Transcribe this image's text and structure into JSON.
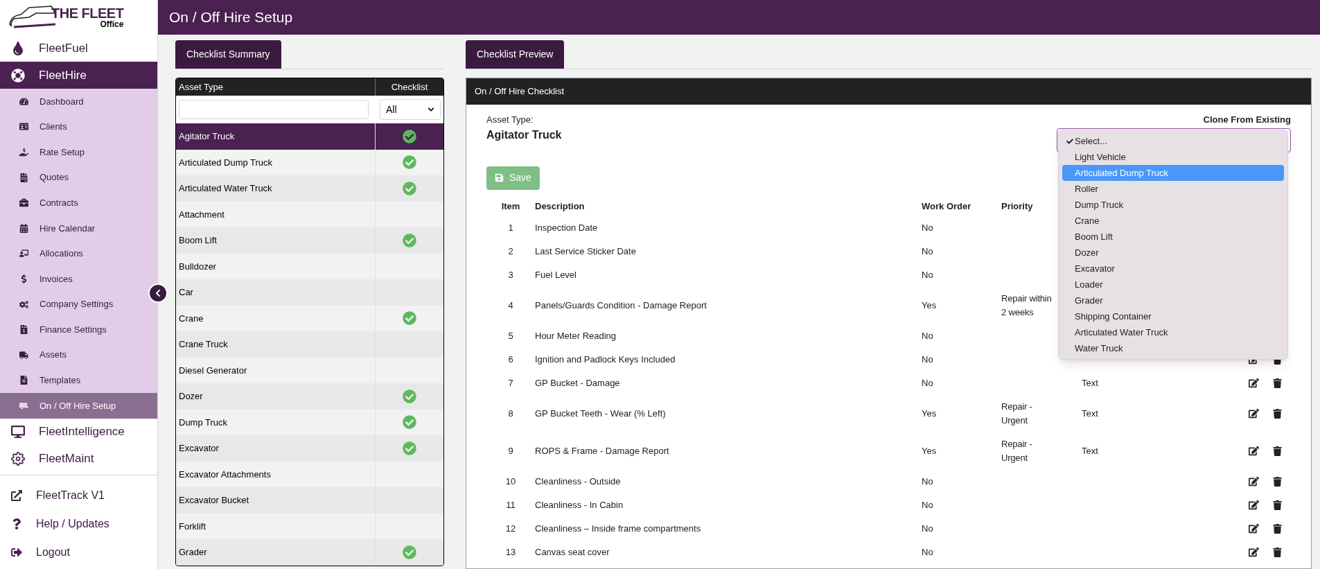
{
  "logo": {
    "title": "THE FLEET",
    "subtitle": "Office"
  },
  "page_title": "On / Off Hire Setup",
  "sidebar": {
    "modules": [
      {
        "label": "FleetFuel",
        "expanded": false
      },
      {
        "label": "FleetHire",
        "expanded": true,
        "children": [
          {
            "label": "Dashboard",
            "selected": false
          },
          {
            "label": "Clients",
            "selected": false
          },
          {
            "label": "Rate Setup",
            "selected": false
          },
          {
            "label": "Quotes",
            "selected": false
          },
          {
            "label": "Contracts",
            "selected": false
          },
          {
            "label": "Hire Calendar",
            "selected": false
          },
          {
            "label": "Allocations",
            "selected": false
          },
          {
            "label": "Invoices",
            "selected": false
          },
          {
            "label": "Company Settings",
            "selected": false
          },
          {
            "label": "Finance Settings",
            "selected": false
          },
          {
            "label": "Assets",
            "selected": false
          },
          {
            "label": "Templates",
            "selected": false
          },
          {
            "label": "On / Off Hire Setup",
            "selected": true
          }
        ]
      },
      {
        "label": "FleetIntelligence",
        "expanded": false
      },
      {
        "label": "FleetMaint",
        "expanded": false
      }
    ],
    "footer_items": [
      "FleetTrack V1",
      "Help / Updates",
      "Logout"
    ]
  },
  "summary": {
    "tab": {
      "label": "Checklist Summary",
      "selected": true
    },
    "columns": [
      "Asset Type",
      "Checklist"
    ],
    "filter": {
      "value": "All"
    },
    "rows": [
      {
        "name": "Agitator Truck",
        "has_checklist": true,
        "selected": true
      },
      {
        "name": "Articulated Dump Truck",
        "has_checklist": true,
        "selected": false
      },
      {
        "name": "Articulated Water Truck",
        "has_checklist": true,
        "selected": false
      },
      {
        "name": "Attachment",
        "has_checklist": false,
        "selected": false
      },
      {
        "name": "Boom Lift",
        "has_checklist": true,
        "selected": false
      },
      {
        "name": "Bulldozer",
        "has_checklist": false,
        "selected": false
      },
      {
        "name": "Car",
        "has_checklist": false,
        "selected": false
      },
      {
        "name": "Crane",
        "has_checklist": true,
        "selected": false
      },
      {
        "name": "Crane Truck",
        "has_checklist": false,
        "selected": false
      },
      {
        "name": "Diesel Generator",
        "has_checklist": false,
        "selected": false
      },
      {
        "name": "Dozer",
        "has_checklist": true,
        "selected": false
      },
      {
        "name": "Dump Truck",
        "has_checklist": true,
        "selected": false
      },
      {
        "name": "Excavator",
        "has_checklist": true,
        "selected": false
      },
      {
        "name": "Excavator Attachments",
        "has_checklist": false,
        "selected": false
      },
      {
        "name": "Excavator Bucket",
        "has_checklist": false,
        "selected": false
      },
      {
        "name": "Forklift",
        "has_checklist": false,
        "selected": false
      },
      {
        "name": "Grader",
        "has_checklist": true,
        "selected": false
      }
    ]
  },
  "preview": {
    "tab": {
      "label": "Checklist Preview",
      "selected": true
    },
    "card_title": "On / Off Hire Checklist",
    "asset_type_label": "Asset Type:",
    "asset_type": "Agitator Truck",
    "clone": {
      "label": "Clone From Existing",
      "options": [
        {
          "label": "Select...",
          "selected": true,
          "highlighted": false
        },
        {
          "label": "Light Vehicle",
          "selected": false,
          "highlighted": false
        },
        {
          "label": "Articulated Dump Truck",
          "selected": false,
          "highlighted": true
        },
        {
          "label": "Roller",
          "selected": false,
          "highlighted": false
        },
        {
          "label": "Dump Truck",
          "selected": false,
          "highlighted": false
        },
        {
          "label": "Crane",
          "selected": false,
          "highlighted": false
        },
        {
          "label": "Boom Lift",
          "selected": false,
          "highlighted": false
        },
        {
          "label": "Dozer",
          "selected": false,
          "highlighted": false
        },
        {
          "label": "Excavator",
          "selected": false,
          "highlighted": false
        },
        {
          "label": "Loader",
          "selected": false,
          "highlighted": false
        },
        {
          "label": "Grader",
          "selected": false,
          "highlighted": false
        },
        {
          "label": "Shipping Container",
          "selected": false,
          "highlighted": false
        },
        {
          "label": "Articulated Water Truck",
          "selected": false,
          "highlighted": false
        },
        {
          "label": "Water Truck",
          "selected": false,
          "highlighted": false
        }
      ]
    },
    "save": {
      "label": "Save",
      "disabled": true
    },
    "columns": [
      "Item",
      "Description",
      "Work Order",
      "Priority"
    ],
    "rows": [
      {
        "item": "1",
        "description": "Inspection Date",
        "work_order": "No"
      },
      {
        "item": "2",
        "description": "Last Service Sticker Date",
        "work_order": "No"
      },
      {
        "item": "3",
        "description": "Fuel Level",
        "work_order": "No"
      },
      {
        "item": "4",
        "description": "Panels/Guards Condition - Damage Report",
        "work_order": "Yes",
        "priority": "Repair within 2 weeks"
      },
      {
        "item": "5",
        "description": "Hour Meter Reading",
        "work_order": "No"
      },
      {
        "item": "6",
        "description": "Ignition and Padlock Keys Included",
        "work_order": "No"
      },
      {
        "item": "7",
        "description": "GP Bucket - Damage",
        "work_order": "No",
        "column_5": "Text"
      },
      {
        "item": "8",
        "description": "GP Bucket Teeth - Wear (% Left)",
        "work_order": "Yes",
        "priority": "Repair - Urgent",
        "column_5": "Text"
      },
      {
        "item": "9",
        "description": "ROPS & Frame - Damage Report",
        "work_order": "Yes",
        "priority": "Repair - Urgent",
        "column_5": "Text"
      },
      {
        "item": "10",
        "description": "Cleanliness - Outside",
        "work_order": "No"
      },
      {
        "item": "11",
        "description": "Cleanliness - In Cabin",
        "work_order": "No"
      },
      {
        "item": "12",
        "description": "Cleanliness – Inside frame compartments",
        "work_order": "No"
      },
      {
        "item": "13",
        "description": "Canvas seat cover",
        "work_order": "No"
      }
    ]
  }
}
